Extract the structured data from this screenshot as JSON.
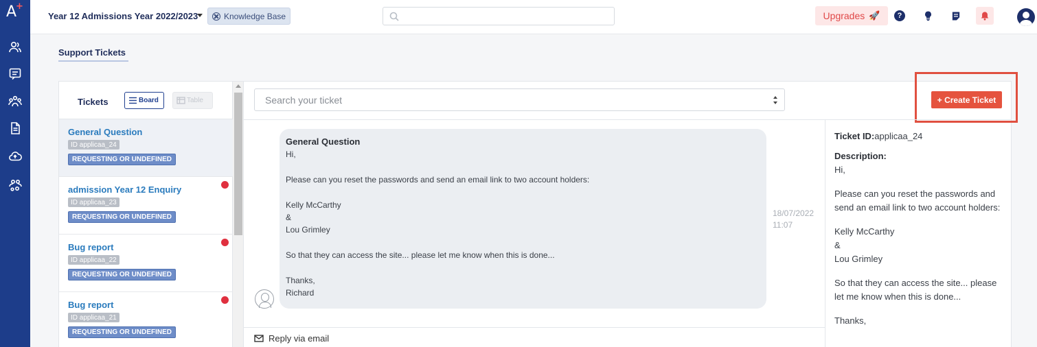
{
  "rail": {
    "logo": "A",
    "logo_plus": "+",
    "icons": [
      "users-icon",
      "chat-icon",
      "group-icon",
      "document-icon",
      "cloud-upload-icon",
      "team-settings-icon"
    ]
  },
  "topbar": {
    "year_title": "Year 12 Admissions Year 2022/2023",
    "knowledge_base": "Knowledge Base",
    "search_placeholder": "",
    "upgrades_label": "Upgrades",
    "upgrades_emoji": "🚀",
    "help_label": "?"
  },
  "page": {
    "tab": "Support Tickets"
  },
  "list": {
    "title": "Tickets",
    "board_label": "Board",
    "table_label": "Table",
    "tickets": [
      {
        "name": "General Question",
        "id": "ID applicaa_24",
        "status": "REQUESTING OR UNDEFINED",
        "unread": false
      },
      {
        "name": "admission Year 12 Enquiry",
        "id": "ID applicaa_23",
        "status": "REQUESTING OR UNDEFINED",
        "unread": true
      },
      {
        "name": "Bug report",
        "id": "ID applicaa_22",
        "status": "REQUESTING OR UNDEFINED",
        "unread": true
      },
      {
        "name": "Bug report",
        "id": "ID applicaa_21",
        "status": "REQUESTING OR UNDEFINED",
        "unread": true
      }
    ]
  },
  "middle": {
    "search_placeholder": "Search your ticket",
    "create_button": "+ Create Ticket",
    "message": {
      "subject": "General Question",
      "lines": {
        "greeting": "Hi,",
        "request": "Please can you reset the passwords and send an email link to two account holders:",
        "holder1": "Kelly McCarthy",
        "amp": "&",
        "holder2": "Lou Grimley",
        "followup": "So that they can access the site... please let me know when this is done...",
        "thanks": "Thanks,",
        "sign": "Richard"
      },
      "date": "18/07/2022",
      "time": "11:07"
    },
    "reply_label": "Reply via email"
  },
  "detail": {
    "ticket_id_label": "Ticket ID:",
    "ticket_id": "applicaa_24",
    "description_label": "Description:",
    "greeting": "Hi,",
    "request": "Please can you reset the passwords and send an email link to two account holders:",
    "holder1": "Kelly McCarthy",
    "amp": "&",
    "holder2": "Lou Grimley",
    "followup": "So that they can access the site... please let me know when this is done...",
    "thanks": "Thanks,"
  },
  "colors": {
    "rail": "#1d3d8a",
    "accent": "#e5533e",
    "link": "#2a7bbd",
    "status": "#6e8dc8",
    "unread": "#e0303f"
  }
}
